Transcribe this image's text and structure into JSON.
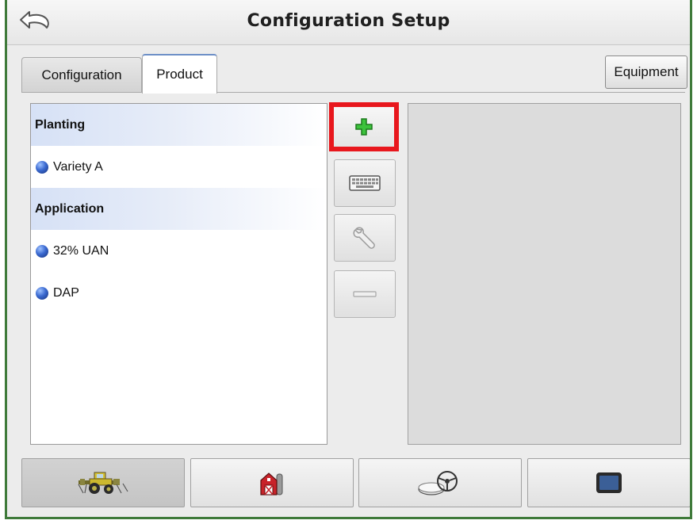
{
  "header": {
    "title": "Configuration Setup"
  },
  "tabs": [
    {
      "label": "Configuration"
    },
    {
      "label": "Product"
    }
  ],
  "equipment_button": {
    "label": "Equipment"
  },
  "product_list": {
    "groups": [
      {
        "label": "Planting",
        "items": [
          "Variety A"
        ]
      },
      {
        "label": "Application",
        "items": [
          "32% UAN",
          "DAP"
        ]
      }
    ]
  },
  "side_buttons": [
    "plus-icon",
    "keyboard-icon",
    "wrench-icon",
    "minus-icon"
  ],
  "bottom_nav": [
    "tractor-icon",
    "barn-icon",
    "guidance-icon",
    "display-icon"
  ],
  "colors": {
    "accent_green": "#3f7a3a",
    "highlight_red": "#e8171d",
    "plus_green": "#2fae2f"
  }
}
